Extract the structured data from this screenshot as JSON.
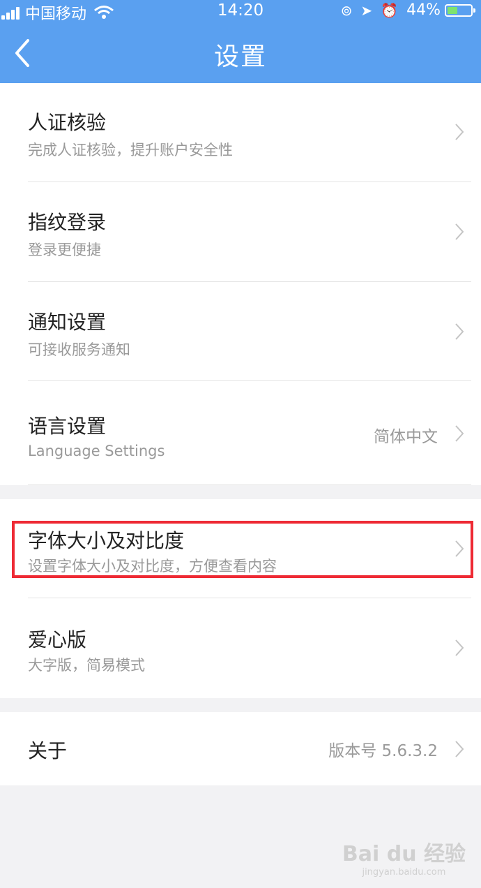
{
  "status": {
    "carrier": "中国移动",
    "time": "14:20",
    "battery": "44%",
    "battery_level": 0.44,
    "colors": {
      "header": "#5aa0f0",
      "battery_fill": "#7ee36f",
      "highlight": "#ee2a34"
    }
  },
  "header": {
    "title": "设置"
  },
  "items": [
    {
      "title": "人证核验",
      "subtitle": "完成人证核验，提升账户安全性"
    },
    {
      "title": "指纹登录",
      "subtitle": "登录更便捷"
    },
    {
      "title": "通知设置",
      "subtitle": "可接收服务通知"
    },
    {
      "title": "语言设置",
      "subtitle": "Language Settings",
      "value": "简体中文"
    },
    {
      "title": "字体大小及对比度",
      "subtitle": "设置字体大小及对比度，方便查看内容"
    },
    {
      "title": "爱心版",
      "subtitle": "大字版，简易模式"
    },
    {
      "title": "关于",
      "value": "版本号 5.6.3.2"
    }
  ],
  "watermark": {
    "brand": "Bai du 经验",
    "url": "jingyan.baidu.com"
  }
}
